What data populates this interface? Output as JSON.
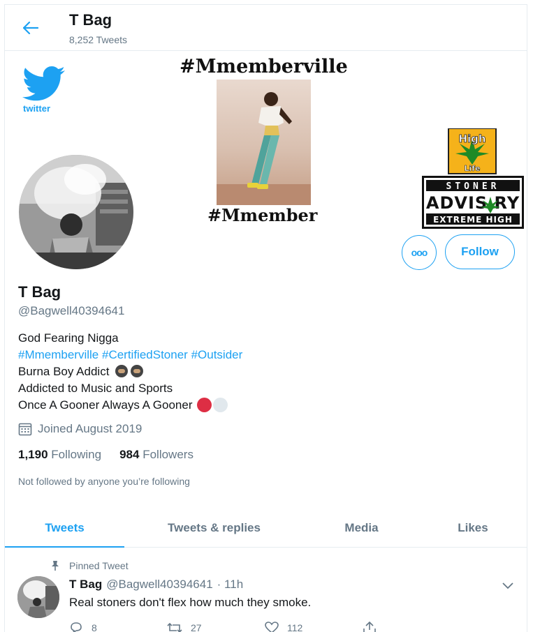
{
  "header": {
    "name": "T Bag",
    "tweet_count": "8,252 Tweets"
  },
  "banner": {
    "title": "#Mmemberville",
    "subtitle": "#Mmember",
    "twitter_word": "twitter",
    "advisory_top": "High",
    "advisory_life": "Life",
    "advisory_stoner": "STONER",
    "advisory_main": "ADVIS RY",
    "advisory_bottom": "EXTREME HIGH"
  },
  "profile": {
    "more_label": "ooo",
    "follow_label": "Follow",
    "name": "T Bag",
    "handle": "@Bagwell40394641",
    "bio_line1": "God Fearing Nigga",
    "hashtags": [
      "#Mmemberville",
      "#CertifiedStoner",
      "#Outsider"
    ],
    "bio_line3": "Burna Boy Addict",
    "bio_line4": "Addicted to Music and Sports",
    "bio_line5": "Once A Gooner Always A Gooner",
    "joined": "Joined August 2019",
    "following_count": "1,190",
    "following_label": "Following",
    "followers_count": "984",
    "followers_label": "Followers",
    "not_followed": "Not followed by anyone you’re following"
  },
  "tabs": [
    {
      "label": "Tweets",
      "active": true
    },
    {
      "label": "Tweets & replies",
      "active": false
    },
    {
      "label": "Media",
      "active": false
    },
    {
      "label": "Likes",
      "active": false
    }
  ],
  "tweet": {
    "pinned_label": "Pinned Tweet",
    "name": "T Bag",
    "handle": "@Bagwell40394641",
    "time": "· 11h",
    "text": "Real stoners don't flex how much they smoke.",
    "replies": "8",
    "retweets": "27",
    "likes": "112"
  },
  "colors": {
    "accent": "#1da1f2",
    "muted": "#657786",
    "text": "#14171a"
  }
}
